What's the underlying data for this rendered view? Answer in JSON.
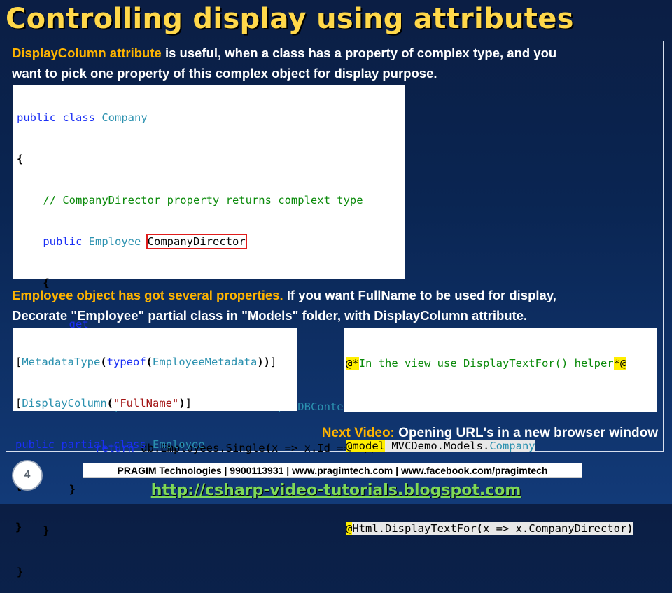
{
  "title": "Controlling display using attributes",
  "intro": {
    "highlight": "DisplayColumn attribute",
    "line1_rest": " is useful, when a class has a property of complex type, and you",
    "line2": "want to pick one property of this complex object for display purpose."
  },
  "code1": [
    {
      "t": "public class Company"
    },
    {
      "t": "{"
    },
    {
      "t": "    // CompanyDirector property returns complext type"
    },
    {
      "t": "    public Employee CompanyDirector"
    },
    {
      "t": "    {"
    },
    {
      "t": "        get"
    },
    {
      "t": "        {"
    },
    {
      "t": "            SampleDBContext db = new SampleDBContext();"
    },
    {
      "t": "            return db.Employees.Single(x => x.Id == 1);"
    },
    {
      "t": "        }"
    },
    {
      "t": "    }"
    },
    {
      "t": "}"
    }
  ],
  "para2": {
    "highlight": "Employee object has got several properties.",
    "line1_rest": " If you want FullName to be used for display,",
    "line2": "Decorate \"Employee\" partial class in \"Models\" folder, with DisplayColumn attribute."
  },
  "code2": [
    "[MetadataType(typeof(EmployeeMetadata))]",
    "[DisplayColumn(\"FullName\")]",
    "public partial class Employee",
    "{",
    "}"
  ],
  "code3": [
    "@*In the view use DisplayTextFor() helper*@",
    "",
    "@model MVCDemo.Models.Company",
    "",
    "@Html.DisplayTextFor(x => x.CompanyDirector)"
  ],
  "next_video": {
    "label": "Next Video:",
    "text": " Opening URL's in a new browser window"
  },
  "slide_number": "4",
  "footer": "PRAGIM Technologies | 9900113931 | www.pragimtech.com | www.facebook.com/pragimtech",
  "url": "http://csharp-video-tutorials.blogspot.com",
  "colors": {
    "title": "#ffd84a",
    "highlight": "#ffb400",
    "keyword": "#1a2ff5",
    "type": "#2b91af",
    "comment": "#0a8a0a",
    "string": "#a31515",
    "url": "#7ed957"
  }
}
